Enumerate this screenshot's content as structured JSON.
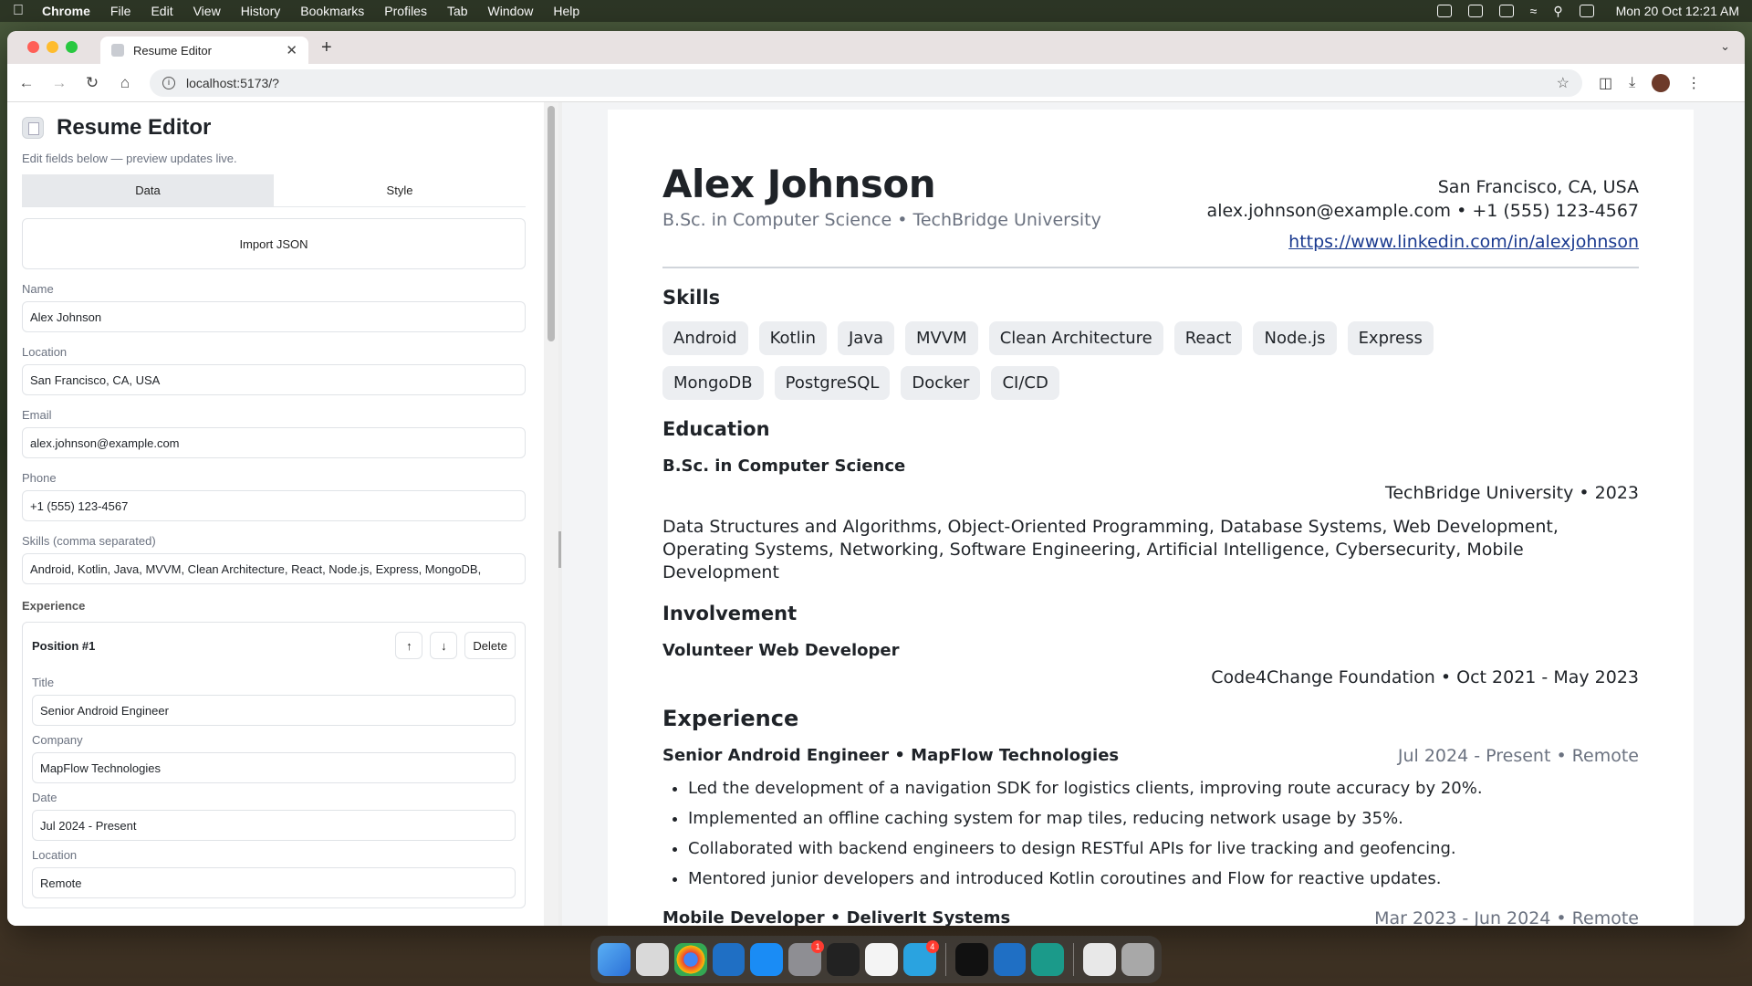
{
  "menubar": {
    "app_name": "Chrome",
    "items": [
      "File",
      "Edit",
      "View",
      "History",
      "Bookmarks",
      "Profiles",
      "Tab",
      "Window",
      "Help"
    ],
    "clock": "Mon 20 Oct  12:21 AM"
  },
  "browser": {
    "tab_title": "Resume Editor",
    "url": "localhost:5173/?"
  },
  "editor": {
    "title": "Resume Editor",
    "subtitle": "Edit fields below — preview updates live.",
    "tabs": [
      "Data",
      "Style"
    ],
    "active_tab": "Data",
    "import_label": "Import JSON",
    "fields": {
      "name": {
        "label": "Name",
        "value": "Alex Johnson"
      },
      "location": {
        "label": "Location",
        "value": "San Francisco, CA, USA"
      },
      "email": {
        "label": "Email",
        "value": "alex.johnson@example.com"
      },
      "phone": {
        "label": "Phone",
        "value": "+1 (555) 123-4567"
      },
      "skills": {
        "label": "Skills (comma separated)",
        "value": "Android, Kotlin, Java, MVVM, Clean Architecture, React, Node.js, Express, MongoDB,"
      }
    },
    "experience_label": "Experience",
    "position": {
      "heading": "Position #1",
      "up": "↑",
      "down": "↓",
      "delete": "Delete",
      "title": {
        "label": "Title",
        "value": "Senior Android Engineer"
      },
      "company": {
        "label": "Company",
        "value": "MapFlow Technologies"
      },
      "date": {
        "label": "Date",
        "value": "Jul 2024 - Present"
      },
      "location": {
        "label": "Location",
        "value": "Remote"
      }
    }
  },
  "resume": {
    "name": "Alex Johnson",
    "degree_line": "B.Sc. in Computer Science • TechBridge University",
    "location": "San Francisco, CA, USA",
    "contact": "alex.johnson@example.com • +1 (555) 123-4567",
    "linkedin": "https://www.linkedin.com/in/alexjohnson",
    "skills_heading": "Skills",
    "skills": [
      "Android",
      "Kotlin",
      "Java",
      "MVVM",
      "Clean Architecture",
      "React",
      "Node.js",
      "Express",
      "MongoDB",
      "PostgreSQL",
      "Docker",
      "CI/CD"
    ],
    "education_heading": "Education",
    "education": {
      "degree": "B.Sc. in Computer Science",
      "school_line": "TechBridge University • 2023",
      "description": "Data Structures and Algorithms, Object-Oriented Programming, Database Systems, Web Development, Operating Systems, Networking, Software Engineering, Artificial Intelligence, Cybersecurity, Mobile Development"
    },
    "involvement_heading": "Involvement",
    "involvement": {
      "role": "Volunteer Web Developer",
      "org_line": "Code4Change Foundation • Oct 2021 - May 2023"
    },
    "experience_heading": "Experience",
    "experience": [
      {
        "role_line": "Senior Android Engineer • MapFlow Technologies",
        "meta": "Jul 2024 - Present • Remote",
        "bullets": [
          "Led the development of a navigation SDK for logistics clients, improving route accuracy by 20%.",
          "Implemented an offline caching system for map tiles, reducing network usage by 35%.",
          "Collaborated with backend engineers to design RESTful APIs for live tracking and geofencing.",
          "Mentored junior developers and introduced Kotlin coroutines and Flow for reactive updates."
        ]
      },
      {
        "role_line": "Mobile Developer • DeliverIt Systems",
        "meta": "Mar 2023 - Jun 2024 • Remote"
      }
    ]
  },
  "dock": {
    "apps": [
      "finder-icon",
      "launchpad-icon",
      "chrome-icon",
      "vscode-icon",
      "app-store-icon",
      "system-settings-icon",
      "activity-monitor-icon",
      "xcode-icon",
      "telegram-icon",
      "terminal-icon",
      "vscode-icon",
      "vscode-insiders-icon",
      "preview-icon",
      "trash-icon"
    ],
    "badges": {
      "system_settings": "1",
      "telegram": "4"
    }
  }
}
